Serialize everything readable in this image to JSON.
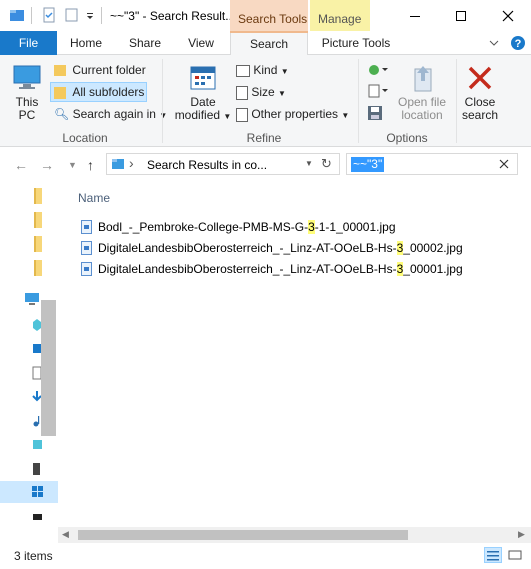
{
  "window": {
    "title": "~~\"3\" - Search Result...",
    "context_tabs": {
      "search_tools": "Search Tools",
      "manage": "Manage"
    }
  },
  "tabs": {
    "file": "File",
    "home": "Home",
    "share": "Share",
    "view": "View",
    "search": "Search",
    "picture_tools": "Picture Tools"
  },
  "ribbon": {
    "location": {
      "this_pc_line1": "This",
      "this_pc_line2": "PC",
      "current_folder": "Current folder",
      "all_subfolders": "All subfolders",
      "search_again_in": "Search again in",
      "label": "Location"
    },
    "refine": {
      "date_line1": "Date",
      "date_line2": "modified",
      "kind": "Kind",
      "size": "Size",
      "other_properties": "Other properties",
      "label": "Refine"
    },
    "options": {
      "open_file_line1": "Open file",
      "open_file_line2": "location",
      "close_search_line1": "Close",
      "close_search_line2": "search",
      "label": "Options"
    }
  },
  "address": {
    "path": "Search Results in co...",
    "search_query": "~~\"3\""
  },
  "content": {
    "column_name": "Name",
    "files": [
      {
        "pre": "Bodl_-_Pembroke-College-PMB-MS-G-",
        "hl": "3",
        "post": "-1-1_00001.jpg"
      },
      {
        "pre": "DigitaleLandesbibOberosterreich_-_Linz-AT-OOeLB-Hs-",
        "hl": "3",
        "post": "_00002.jpg"
      },
      {
        "pre": "DigitaleLandesbibOberosterreich_-_Linz-AT-OOeLB-Hs-",
        "hl": "3",
        "post": "_00001.jpg"
      }
    ]
  },
  "status": {
    "item_count": "3 items"
  },
  "colors": {
    "file_tab": "#1979ca",
    "search_tools_tab": "#f8d9c2",
    "manage_tab": "#f9f2a6",
    "selection": "#cce8ff",
    "highlight": "#fffd7a"
  }
}
